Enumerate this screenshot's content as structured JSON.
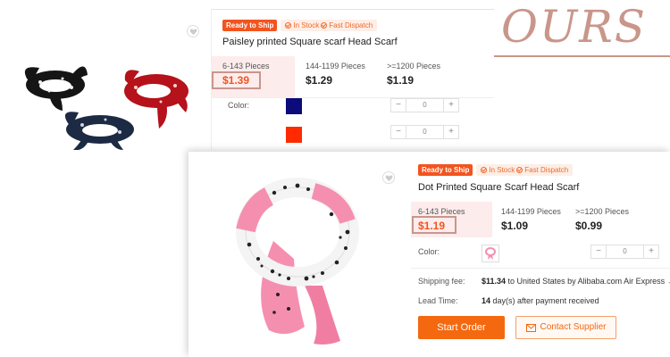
{
  "overlay": {
    "label": "OURS",
    "color": "#c9968a"
  },
  "products": [
    {
      "badges": {
        "ready": "Ready to Ship",
        "stock": "In Stock",
        "dispatch": "Fast Dispatch"
      },
      "title": "Paisley printed Square scarf Head Scarf",
      "tiers": [
        {
          "qty": "6-143 Pieces",
          "price": "$1.39"
        },
        {
          "qty": "144-1199 Pieces",
          "price": "$1.29"
        },
        {
          "qty": ">=1200 Pieces",
          "price": "$1.19"
        }
      ],
      "color_label": "Color:",
      "colors": [
        "#0b0b7a",
        "#ff2a00"
      ],
      "quantities": [
        "0",
        "0"
      ],
      "image_desc": "paisley-bandana-scarves"
    },
    {
      "badges": {
        "ready": "Ready to Ship",
        "stock": "In Stock",
        "dispatch": "Fast Dispatch"
      },
      "title": "Dot Printed Square Scarf Head Scarf",
      "tiers": [
        {
          "qty": "6-143 Pieces",
          "price": "$1.19"
        },
        {
          "qty": "144-1199 Pieces",
          "price": "$1.09"
        },
        {
          "qty": ">=1200 Pieces",
          "price": "$0.99"
        }
      ],
      "color_label": "Color:",
      "quantities": [
        "0"
      ],
      "shipping_label": "Shipping fee:",
      "shipping_amount": "$11.34",
      "shipping_text": "to United States by Alibaba.com Air Express",
      "lead_label": "Lead Time:",
      "lead_days": "14",
      "lead_text": "day(s) after payment received",
      "start_order": "Start Order",
      "contact_supplier": "Contact Supplier"
    }
  ],
  "colors": {
    "accent": "#f2541f",
    "highlight_box": "#c9968a",
    "tier_bg": "#fdecec",
    "button": "#f4690f"
  }
}
